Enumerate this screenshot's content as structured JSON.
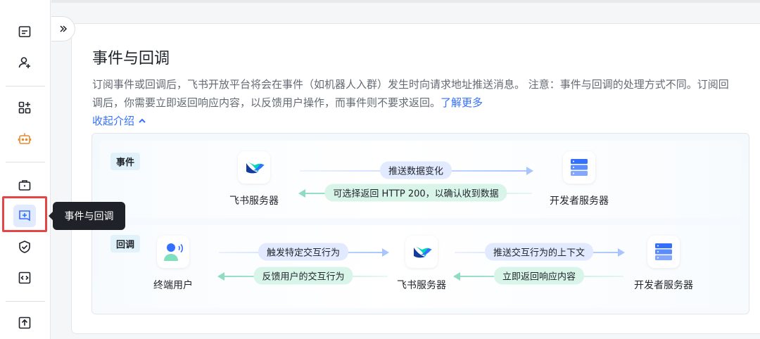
{
  "page": {
    "title": "事件与回调",
    "description": "订阅事件或回调后，飞书开放平台将会在事件（如机器人入群）发生时向请求地址推送消息。 注意：事件与回调的处理方式不同。订阅回调后，你需要立即返回响应内容，以反馈用户操作，而事件则不要求返回。",
    "learn_more": "了解更多",
    "collapse_intro": "收起介绍"
  },
  "tooltip": "事件与回调",
  "diagram": {
    "event": {
      "tag": "事件",
      "source": "飞书服务器",
      "target": "开发者服务器",
      "push_label": "推送数据变化",
      "return_label": "可选择返回 HTTP 200，以确认收到数据"
    },
    "callback": {
      "tag": "回调",
      "user": "终端用户",
      "feishu": "飞书服务器",
      "developer": "开发者服务器",
      "trigger_label": "触发特定交互行为",
      "feedback_label": "反馈用户的交互行为",
      "push_context_label": "推送交互行为的上下文",
      "return_label": "立即返回响应内容"
    }
  },
  "colors": {
    "accent": "#3370ff",
    "highlight": "#e54545",
    "tooltip_bg": "#1f2329"
  }
}
